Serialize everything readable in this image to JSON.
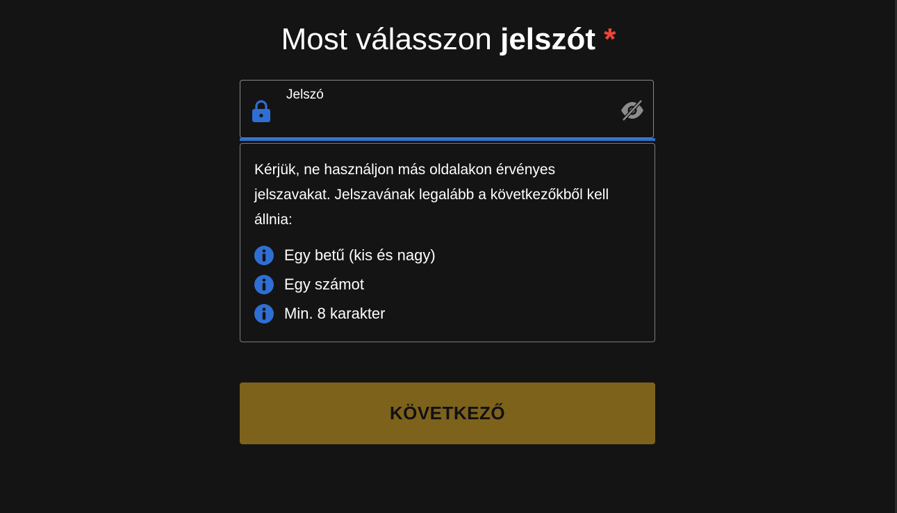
{
  "heading": {
    "prefix": "Most válasszon ",
    "emphasis": "jelszót",
    "required_mark": "*"
  },
  "password_field": {
    "label": "Jelszó",
    "value": "",
    "placeholder": "",
    "lock_icon": "lock-icon",
    "visibility_icon": "eye-off-icon"
  },
  "hint": {
    "text": "Kérjük, ne használjon más oldalakon érvényes jelszavakat. Jelszavának legalább a következőkből kell állnia:",
    "requirements": [
      {
        "label": "Egy betű (kis és nagy)",
        "icon": "info-icon"
      },
      {
        "label": "Egy számot",
        "icon": "info-icon"
      },
      {
        "label": "Min. 8 karakter",
        "icon": "info-icon"
      }
    ]
  },
  "next_button": {
    "label": "KÖVETKEZŐ"
  },
  "colors": {
    "background": "#141414",
    "accent_blue": "#2f6fd3",
    "required_red": "#f0453a",
    "button_gold": "#7d621c",
    "border_gray": "#8a8a8a"
  }
}
